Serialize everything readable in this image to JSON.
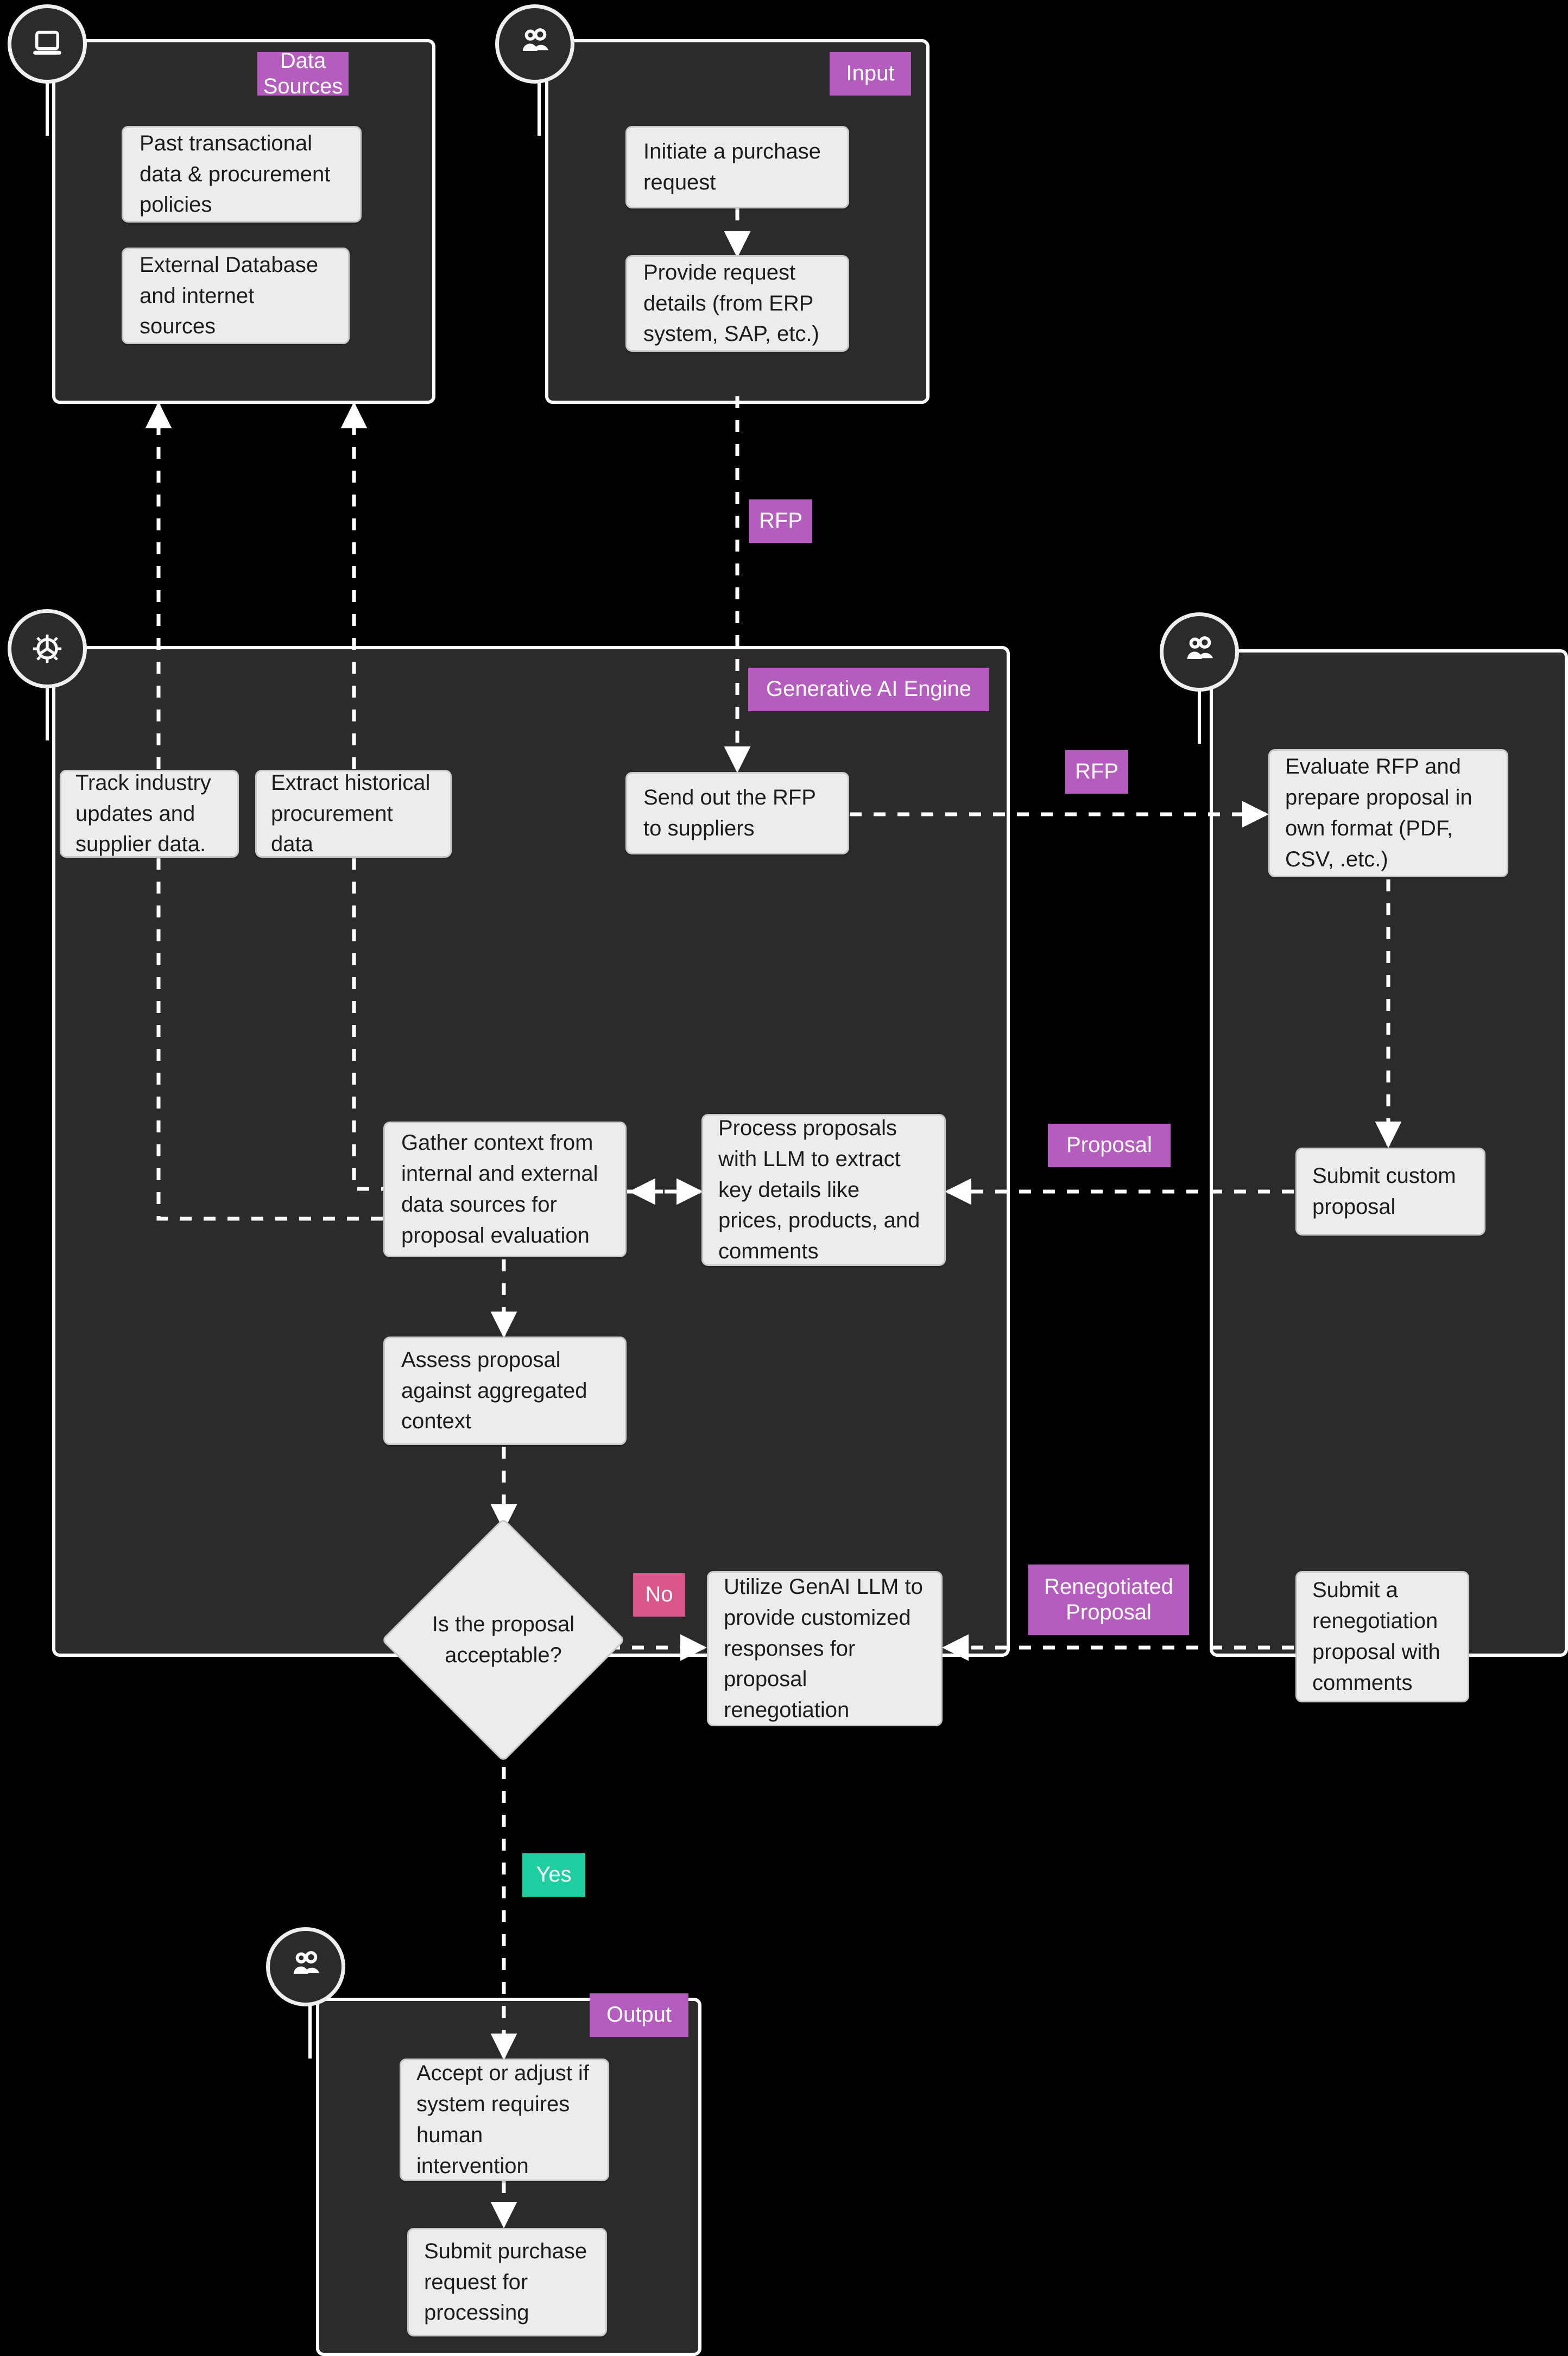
{
  "diagram": {
    "title": "Generative AI procurement / RFP workflow",
    "colors": {
      "group_fill": "#2b2b2b",
      "group_border": "#ffffff",
      "node_fill": "#ececec",
      "node_text": "#1c1c1c",
      "badge_purple": "#b45dbe",
      "badge_green": "#20cfa1",
      "badge_pink": "#d9568a",
      "canvas": "#000000"
    }
  },
  "groups": [
    {
      "id": "data-sources",
      "label": "Data Sources",
      "icon": "laptop-icon"
    },
    {
      "id": "input",
      "label": "Input",
      "icon": "users-icon"
    },
    {
      "id": "genai",
      "label": "Generative AI Engine",
      "icon": "gear-icon"
    },
    {
      "id": "supplier",
      "label": "",
      "icon": "users-icon"
    },
    {
      "id": "output",
      "label": "Output",
      "icon": "users-icon"
    }
  ],
  "nodes": {
    "past_data": "Past transactional data & procurement policies",
    "external_db": "External Database and internet sources",
    "initiate": "Initiate a purchase request",
    "provide_details": "Provide request details (from ERP system, SAP, etc.)",
    "track_industry": "Track industry updates and supplier data.",
    "extract_hist": "Extract historical procurement data",
    "send_rfp": "Send out the RFP to suppliers",
    "gather_context": "Gather context from internal and external data sources for proposal evaluation",
    "process_proposals": "Process proposals with LLM to extract key details like prices, products, and comments",
    "assess_proposal": "Assess proposal against aggregated context",
    "decision": "Is the proposal acceptable?",
    "utilize_genai": "Utilize GenAI LLM to provide customized responses for proposal renegotiation",
    "evaluate_rfp": "Evaluate RFP and prepare proposal in own format (PDF, CSV, .etc.)",
    "submit_custom": "Submit custom proposal",
    "submit_reneg": "Submit a renegotiation proposal with comments",
    "accept_adjust": "Accept or adjust if system requires human intervention",
    "submit_purchase": "Submit purchase request for processing"
  },
  "edge_labels": {
    "rfp_down": "RFP",
    "rfp_across": "RFP",
    "proposal": "Proposal",
    "renegotiated": "Renegotiated Proposal",
    "no": "No",
    "yes": "Yes"
  }
}
